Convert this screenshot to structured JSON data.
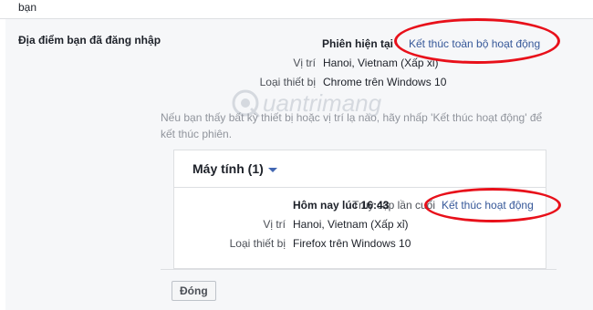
{
  "top_text": "bạn",
  "section": {
    "title": "Địa điểm bạn đã đăng nhập"
  },
  "current_session": {
    "label": "Phiên hiện tại",
    "end_all_link": "Kết thúc toàn bộ hoạt động",
    "location_label": "Vị trí",
    "location_value": "Hanoi, Vietnam (Xấp xỉ)",
    "device_label": "Loại thiết bị",
    "device_value": "Chrome trên Windows 10"
  },
  "note": "Nếu bạn thấy bất kỳ thiết bị hoặc vị trí lạ nào, hãy nhấp 'Kết thúc hoạt động' để kết thúc phiên.",
  "device_group": {
    "title": "Máy tính (1)",
    "last_access_label": "Truy cập lần cuối",
    "last_access_value": "Hôm nay lúc 16:43",
    "end_link": "Kết thúc hoạt động",
    "location_label": "Vị trí",
    "location_value": "Hanoi, Vietnam (Xấp xỉ)",
    "device_label": "Loại thiết bị",
    "device_value": "Firefox trên Windows 10"
  },
  "close_button": "Đóng",
  "watermark": "uantrimang",
  "colors": {
    "link": "#365899",
    "highlight": "#e8101a",
    "panel": "#f6f7f9"
  }
}
